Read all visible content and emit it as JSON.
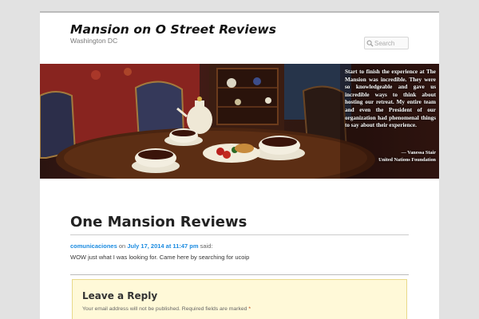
{
  "site": {
    "title": "Mansion on O Street Reviews",
    "description": "Washington DC"
  },
  "search": {
    "placeholder": "Search"
  },
  "banner": {
    "quote": "Start to finish the experience at The Mansion was incredible. They were so knowledgeable and gave us incredible ways to think about hosting our retreat. My entire team and even the President of our organization had phenomenal things to say about their experience.",
    "author": "— Vanessa Stair",
    "organization": "United Nations Foundation"
  },
  "post": {
    "title": "One Mansion Reviews"
  },
  "comment": {
    "author": "comunicaciones",
    "on_text": "on",
    "date": "July 17, 2014 at 11:47 pm",
    "said": "said:",
    "text": "WOW just what I was looking for. Came here by searching for ucoip"
  },
  "reply": {
    "title": "Leave a Reply",
    "notes": "Your email address will not be published. Required fields are marked",
    "required_mark": "*"
  },
  "colors": {
    "link": "#1b8be0",
    "reply_bg": "#fff9d8",
    "page_bg": "#e2e2e2"
  }
}
